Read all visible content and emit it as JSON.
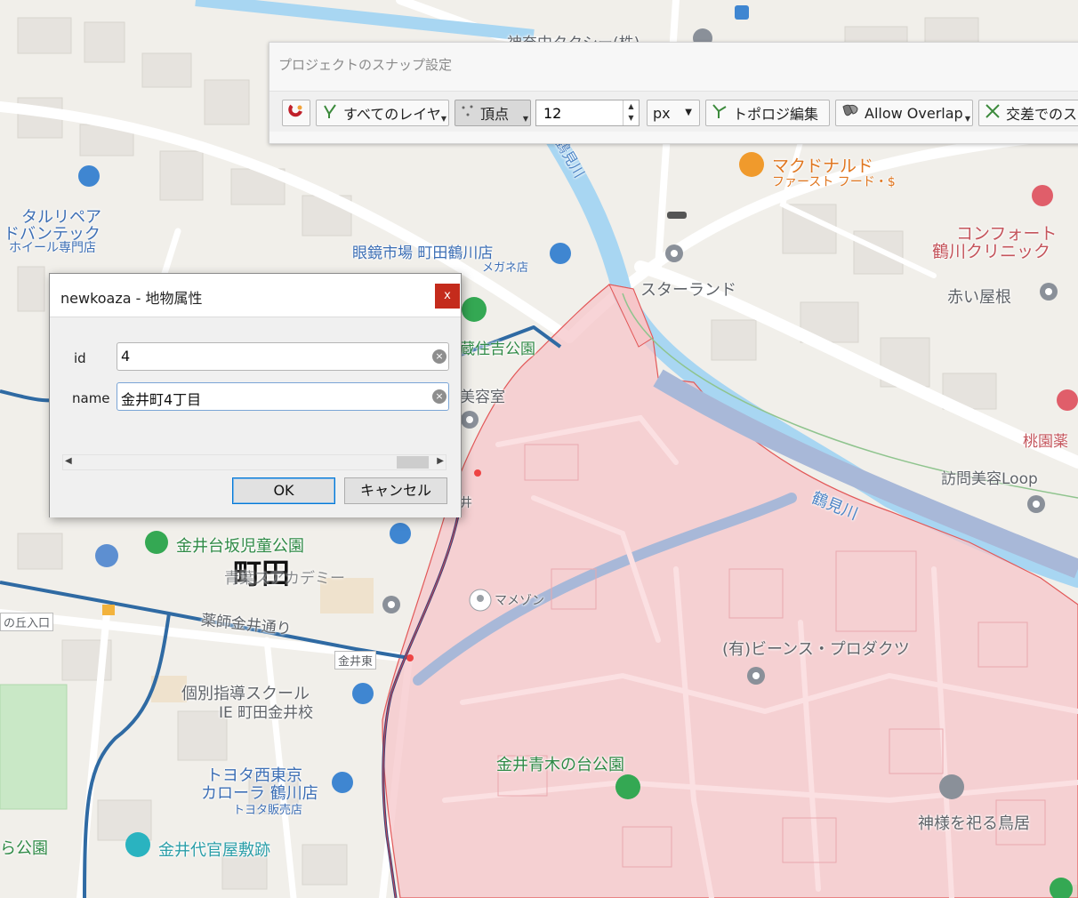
{
  "snapping_toolbar": {
    "title": "プロジェクトのスナップ設定",
    "layer_mode_label": "すべてのレイヤ",
    "snap_type_label": "頂点",
    "tolerance_value": "12",
    "units_label": "px",
    "topology_label": "トポロジ編集",
    "overlap_label": "Allow Overlap",
    "intersection_label": "交差でのス"
  },
  "feature_dialog": {
    "title": "newkoaza - 地物属性",
    "close_label": "x",
    "fields": [
      {
        "label": "id",
        "value": "4"
      },
      {
        "label": "name",
        "value": "金井町4丁目"
      }
    ],
    "ok_label": "OK",
    "cancel_label": "キャンセル"
  },
  "map": {
    "polygon_fill": "#f6c6c9",
    "polygon_stroke": "#e25858",
    "labels": {
      "taxi": "神奈中タクシー(株)",
      "mcdonalds": "マクドナルド",
      "mcdonalds_sub": "ファースト フード・$",
      "wheel_shop_1": "タルリペア",
      "wheel_shop_2": "ドバンテック",
      "wheel_shop_3": "ホイール専門店",
      "megane": "眼鏡市場 町田鶴川店",
      "megane_sub": "メガネ店",
      "comfort_1": "コンフォート",
      "comfort_2": "鶴川クリニック",
      "starland": "スターランド",
      "akai_yane": "赤い屋根",
      "tsurumi_upper": "鶴見川",
      "tsurumi_lower": "鶴見川",
      "park_sumiyoshi": "蔵住吉公園",
      "biyoshitsu": "美容室",
      "momozono": "桃園薬",
      "homon": "訪問美容Loop",
      "kanai": "井",
      "kanaidai_park": "金井台坂児童公園",
      "machida": "町田",
      "academy": "青葉スアカデミー",
      "maison": "マメゾン",
      "okaeno": "の丘入口",
      "yakushi": "薬師金井通り",
      "kanaihigashi": "金井東",
      "beans": "(有)ビーンス・プロダクツ",
      "kobetsu_1": "個別指導スクール",
      "kobetsu_2": "IE 町田金井校",
      "toyota_1": "トヨタ西東京",
      "toyota_2": "カローラ 鶴川店",
      "toyota_3": "トヨタ販売店",
      "aoki_park": "金井青木の台公園",
      "jinja": "神様を祀る鳥居",
      "ra_park": "ら公園",
      "daikanya": "金井代官屋敷跡"
    }
  }
}
